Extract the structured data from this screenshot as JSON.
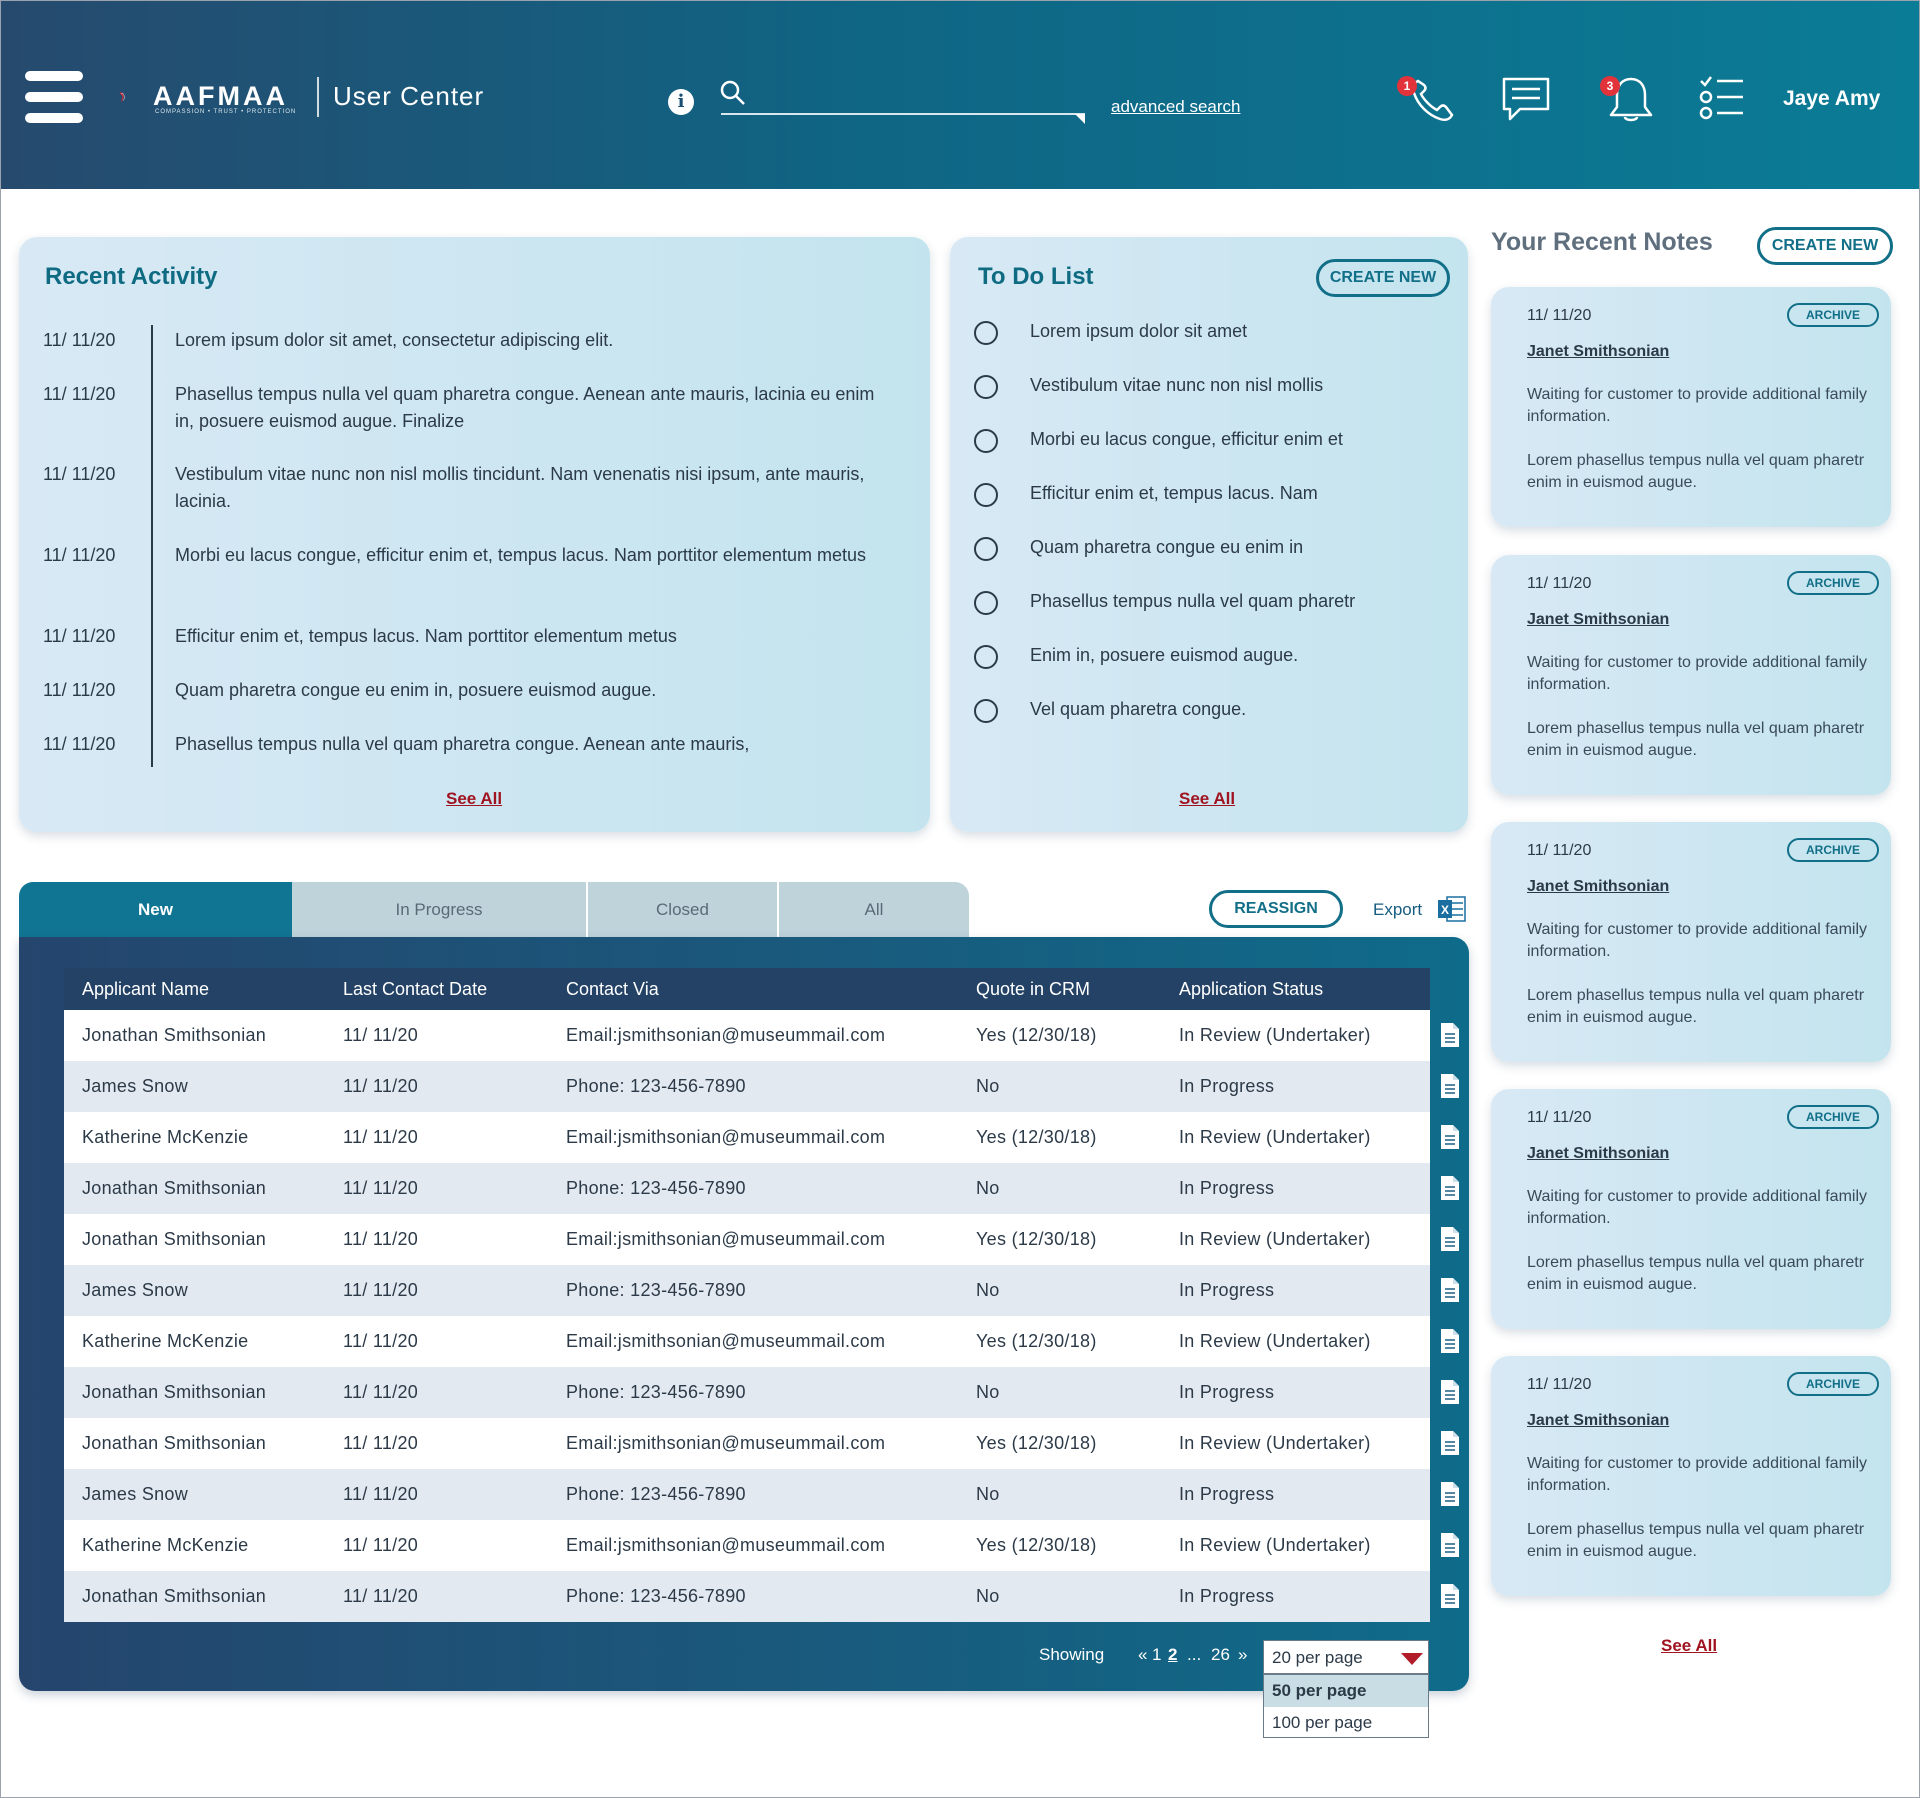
{
  "header": {
    "logo_text": "AAFMAA",
    "logo_tagline": "COMPASSION • TRUST • PROTECTION",
    "app_title": "User Center",
    "search_placeholder": "",
    "advanced_search": "advanced search",
    "phone_badge": "1",
    "bell_badge": "3",
    "user_name": "Jaye Amy"
  },
  "recent_activity": {
    "title": "Recent Activity",
    "see_all": "See All",
    "items": [
      {
        "date": "11/ 11/20",
        "text": "Lorem ipsum dolor sit amet, consectetur adipiscing elit."
      },
      {
        "date": "11/ 11/20",
        "text": "Phasellus tempus nulla vel quam pharetra congue. Aenean ante mauris, lacinia eu enim in, posuere euismod augue. Finalize"
      },
      {
        "date": "11/ 11/20",
        "text": "Vestibulum vitae nunc non nisl mollis tincidunt. Nam venenatis nisi ipsum, ante mauris, lacinia."
      },
      {
        "date": "11/ 11/20",
        "text": "Morbi eu lacus congue, efficitur enim et, tempus lacus. Nam porttitor elementum metus"
      },
      {
        "date": "11/ 11/20",
        "text": "Efficitur enim et, tempus lacus. Nam porttitor elementum metus"
      },
      {
        "date": "11/ 11/20",
        "text": "Quam pharetra congue eu enim in, posuere euismod augue."
      },
      {
        "date": "11/ 11/20",
        "text": "Phasellus tempus nulla vel quam pharetra congue. Aenean ante mauris,"
      }
    ]
  },
  "todo": {
    "title": "To Do List",
    "create_new": "CREATE NEW",
    "see_all": "See All",
    "items": [
      "Lorem ipsum dolor sit amet",
      "Vestibulum vitae nunc non nisl mollis",
      "Morbi eu lacus congue, efficitur enim et",
      "Efficitur enim et, tempus lacus. Nam",
      "Quam pharetra congue eu enim in",
      "Phasellus tempus nulla vel quam pharetr",
      "Enim in, posuere euismod augue.",
      "Vel quam pharetra congue."
    ]
  },
  "notes": {
    "title": "Your Recent Notes",
    "create_new": "CREATE NEW",
    "see_all": "See All",
    "items": [
      {
        "date": "11/ 11/20",
        "archive": "ARCHIVE",
        "author": "Janet Smithsonian",
        "line1": "Waiting for customer to provide additional family information.",
        "line2": "Lorem phasellus tempus nulla vel quam pharetr enim in euismod augue."
      },
      {
        "date": "11/ 11/20",
        "archive": "ARCHIVE",
        "author": "Janet Smithsonian",
        "line1": "Waiting for customer to provide additional family information.",
        "line2": "Lorem phasellus tempus nulla vel quam pharetr enim in euismod augue."
      },
      {
        "date": "11/ 11/20",
        "archive": "ARCHIVE",
        "author": "Janet Smithsonian",
        "line1": "Waiting for customer to provide additional family information.",
        "line2": "Lorem phasellus tempus nulla vel quam pharetr enim in euismod augue."
      },
      {
        "date": "11/ 11/20",
        "archive": "ARCHIVE",
        "author": "Janet Smithsonian",
        "line1": "Waiting for customer to provide additional family information.",
        "line2": "Lorem phasellus tempus nulla vel quam pharetr enim in euismod augue."
      },
      {
        "date": "11/ 11/20",
        "archive": "ARCHIVE",
        "author": "Janet Smithsonian",
        "line1": "Waiting for customer to provide additional family information.",
        "line2": "Lorem phasellus tempus nulla vel quam pharetr enim in euismod augue."
      }
    ]
  },
  "tabs": [
    "New",
    "In Progress",
    "Closed",
    "All"
  ],
  "actions": {
    "reassign": "REASSIGN",
    "export": "Export"
  },
  "table": {
    "columns": [
      "Applicant Name",
      "Last Contact Date",
      "Contact Via",
      "Quote in CRM",
      "Application Status"
    ],
    "rows": [
      [
        "Jonathan Smithsonian",
        "11/ 11/20",
        "Email:jsmithsonian@museummail.com",
        "Yes (12/30/18)",
        "In Review (Undertaker)"
      ],
      [
        "James Snow",
        "11/ 11/20",
        "Phone: 123-456-7890",
        "No",
        "In Progress"
      ],
      [
        "Katherine McKenzie",
        "11/ 11/20",
        "Email:jsmithsonian@museummail.com",
        "Yes (12/30/18)",
        "In Review (Undertaker)"
      ],
      [
        "Jonathan Smithsonian",
        "11/ 11/20",
        "Phone: 123-456-7890",
        "No",
        "In Progress"
      ],
      [
        "Jonathan Smithsonian",
        "11/ 11/20",
        "Email:jsmithsonian@museummail.com",
        "Yes (12/30/18)",
        "In Review (Undertaker)"
      ],
      [
        "James Snow",
        "11/ 11/20",
        "Phone: 123-456-7890",
        "No",
        "In Progress"
      ],
      [
        "Katherine McKenzie",
        "11/ 11/20",
        "Email:jsmithsonian@museummail.com",
        "Yes (12/30/18)",
        "In Review (Undertaker)"
      ],
      [
        "Jonathan Smithsonian",
        "11/ 11/20",
        "Phone: 123-456-7890",
        "No",
        "In Progress"
      ],
      [
        "Jonathan Smithsonian",
        "11/ 11/20",
        "Email:jsmithsonian@museummail.com",
        "Yes (12/30/18)",
        "In Review (Undertaker)"
      ],
      [
        "James Snow",
        "11/ 11/20",
        "Phone: 123-456-7890",
        "No",
        "In Progress"
      ],
      [
        "Katherine McKenzie",
        "11/ 11/20",
        "Email:jsmithsonian@museummail.com",
        "Yes (12/30/18)",
        "In Review (Undertaker)"
      ],
      [
        "Jonathan Smithsonian",
        "11/ 11/20",
        "Phone: 123-456-7890",
        "No",
        "In Progress"
      ]
    ]
  },
  "pagination": {
    "showing": "Showing",
    "prev": "«",
    "page1": "1",
    "page2": "2",
    "ellipsis": "...",
    "last": "26",
    "next": "»",
    "selected": "20 per page",
    "options": [
      "50 per page",
      "100 per page"
    ]
  },
  "colors": {
    "accent": "#107592",
    "alert": "#a01421",
    "header_dark": "#264a6e"
  }
}
